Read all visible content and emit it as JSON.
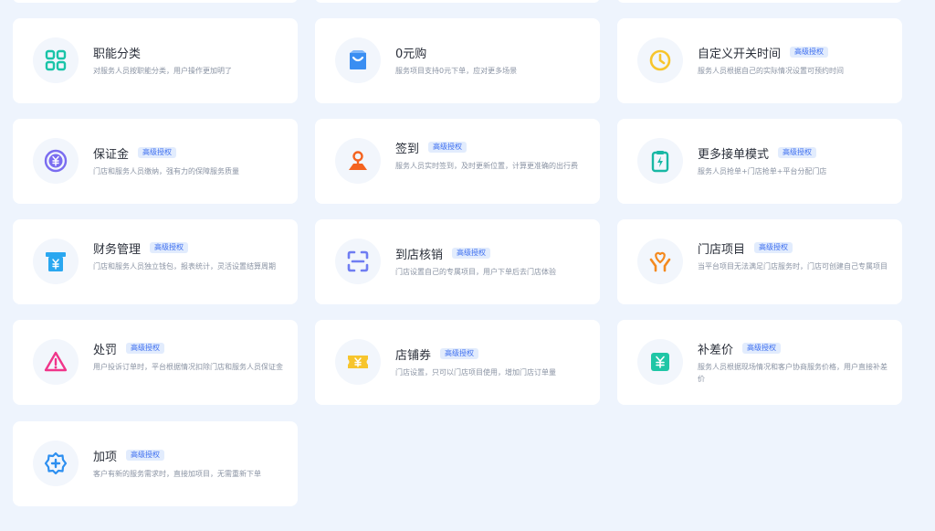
{
  "cards": [
    {
      "title": "职能分类",
      "badge": "",
      "desc": "对服务人员按职能分类，用户操作更加明了",
      "icon": "grid-icon"
    },
    {
      "title": "0元购",
      "badge": "",
      "desc": "服务项目支持0元下单，应对更多场景",
      "icon": "shopping-bag-icon"
    },
    {
      "title": "自定义开关时间",
      "badge": "高级授权",
      "desc": "服务人员根据自己的实际情况设置可预约时间",
      "icon": "clock-icon"
    },
    {
      "title": "保证金",
      "badge": "高级授权",
      "desc": "门店和服务人员缴纳，强有力的保障服务质量",
      "icon": "yuan-coin-icon"
    },
    {
      "title": "签到",
      "badge": "高级授权",
      "desc": "服务人员实时签到，及时更新位置，计算更准确的出行费",
      "icon": "location-pin-icon"
    },
    {
      "title": "更多接单模式",
      "badge": "高级授权",
      "desc": "服务人员抢单+门店抢单+平台分配门店",
      "icon": "clipboard-bolt-icon"
    },
    {
      "title": "财务管理",
      "badge": "高级授权",
      "desc": "门店和服务人员独立钱包，报表统计，灵活设置结算周期",
      "icon": "finance-icon"
    },
    {
      "title": "到店核销",
      "badge": "高级授权",
      "desc": "门店设置自己的专属项目，用户下单后去门店体验",
      "icon": "scan-icon"
    },
    {
      "title": "门店项目",
      "badge": "高级授权",
      "desc": "当平台项目无法满足门店服务时，门店可创建自己专属项目",
      "icon": "heart-hands-icon"
    },
    {
      "title": "处罚",
      "badge": "高级授权",
      "desc": "用户投诉订单时，平台根据情况扣除门店和服务人员保证金",
      "icon": "warning-icon"
    },
    {
      "title": "店铺券",
      "badge": "高级授权",
      "desc": "门店设置，只可以门店项目使用，增加门店订单量",
      "icon": "coupon-icon"
    },
    {
      "title": "补差价",
      "badge": "高级授权",
      "desc": "服务人员根据现场情况和客户协商服务价格，用户直接补差价",
      "icon": "yuan-ticket-icon"
    },
    {
      "title": "加项",
      "badge": "高级授权",
      "desc": "客户有新的服务需求时，直接加项目，无需重新下单",
      "icon": "add-badge-icon"
    }
  ]
}
